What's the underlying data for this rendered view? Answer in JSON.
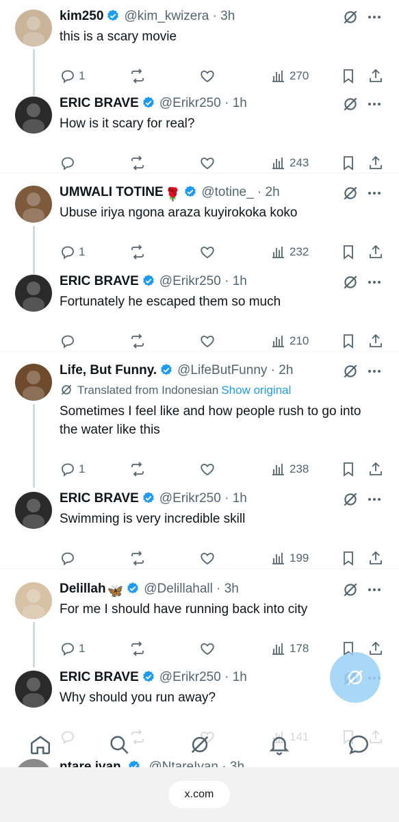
{
  "tweets": [
    {
      "name": "kim250",
      "handle": "@kim_kwizera",
      "time": "· 3h",
      "text": "this is a scary movie",
      "replies": "1",
      "views": "270"
    },
    {
      "name": "ERIC BRAVE",
      "handle": "@Erikr250",
      "time": "· 1h",
      "text": "How is it scary for real?",
      "replies": "",
      "views": "243"
    },
    {
      "name": "UMWALI TOTINE",
      "handle": "@totine_",
      "time": "· 2h",
      "text": "Ubuse iriya ngona araza kuyirokoka koko",
      "replies": "1",
      "views": "232",
      "emoji": "🌹"
    },
    {
      "name": "ERIC BRAVE",
      "handle": "@Erikr250",
      "time": "· 1h",
      "text": "Fortunately he escaped them so much",
      "replies": "",
      "views": "210"
    },
    {
      "name": "Life, But Funny.",
      "handle": "@LifeButFunny",
      "time": "· 2h",
      "translated": "Translated from Indonesian",
      "show_original": "Show original",
      "text": "Sometimes I feel like and how people rush to go into the water like this",
      "replies": "1",
      "views": "238"
    },
    {
      "name": "ERIC BRAVE",
      "handle": "@Erikr250",
      "time": "· 1h",
      "text": "Swimming is very incredible skill",
      "replies": "",
      "views": "199"
    },
    {
      "name": "Delillah",
      "handle": "@Delillahall",
      "time": "· 3h",
      "text": "For me I should have running back into city",
      "replies": "1",
      "views": "178",
      "emoji": "🦋"
    },
    {
      "name": "ERIC BRAVE",
      "handle": "@Erikr250",
      "time": "· 1h",
      "text": "Why should you run away?",
      "replies": "",
      "views": "141"
    }
  ],
  "peek": {
    "name": "ntare ivan",
    "handle": "@NtareIvan",
    "time": "· 3h"
  },
  "footer": {
    "url": "x.com"
  },
  "colors": {
    "accent": "#1d9bf0",
    "secondary": "#536471",
    "line": "#cfd9de"
  }
}
